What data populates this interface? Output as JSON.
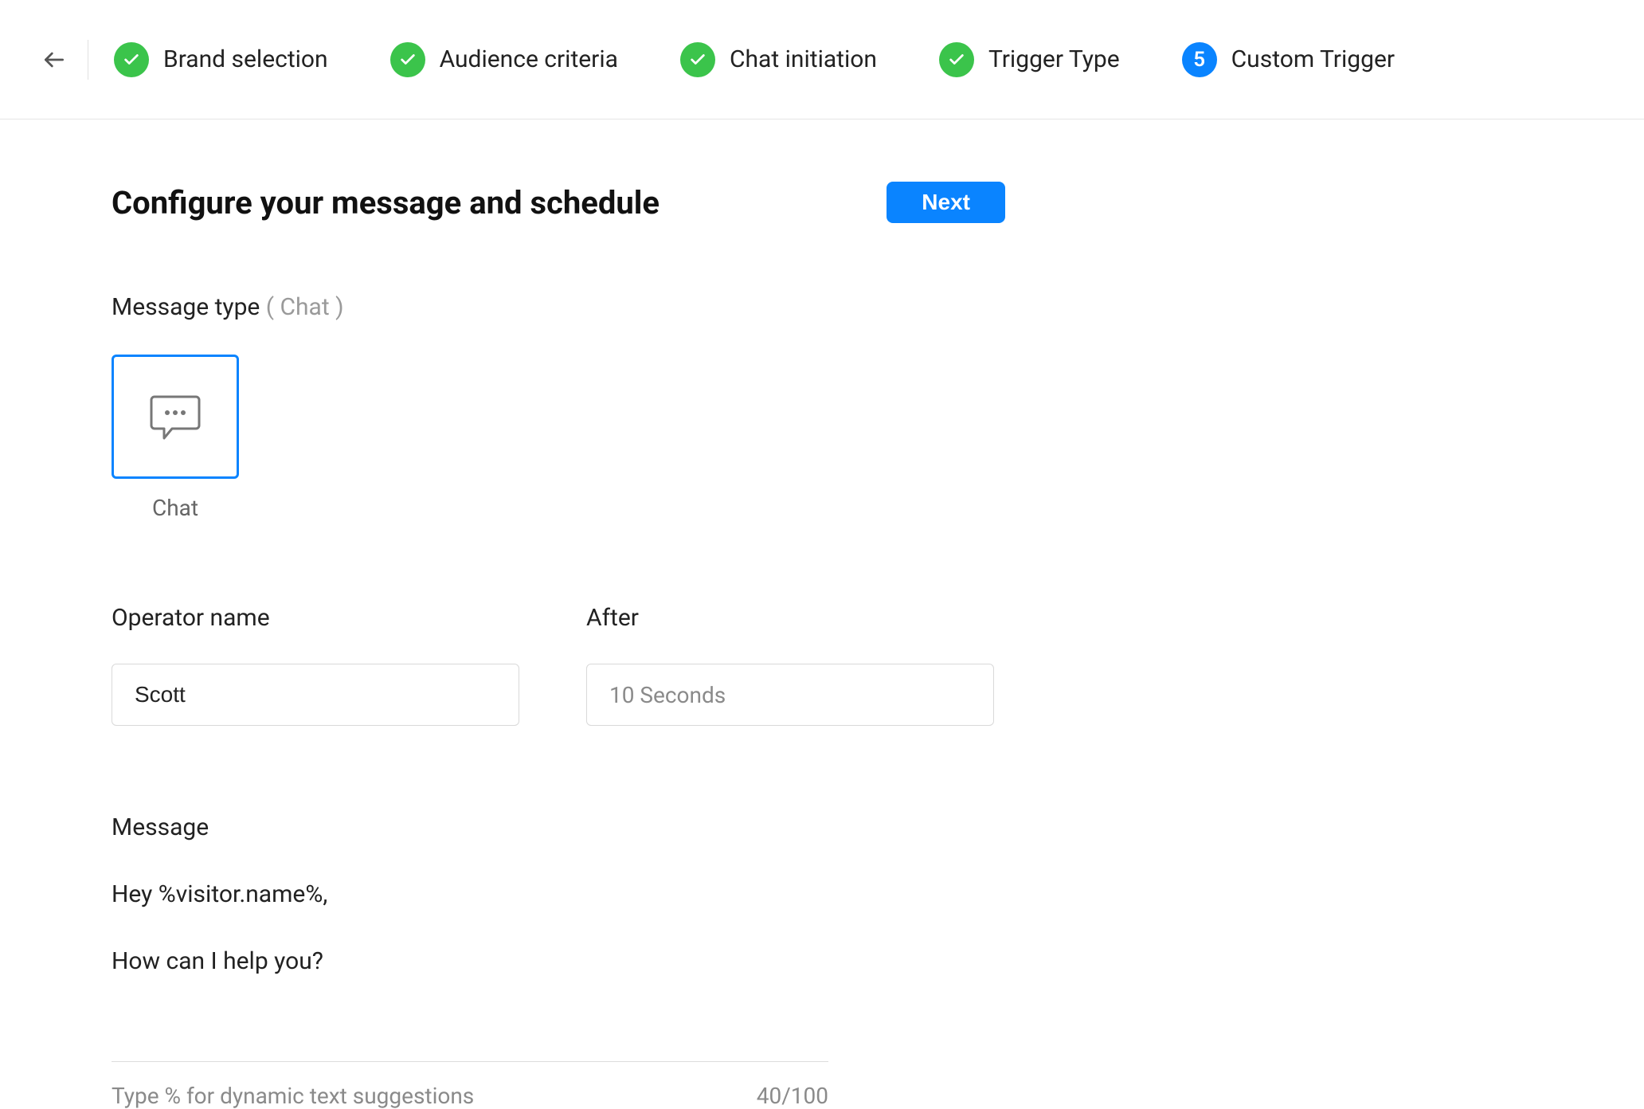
{
  "stepper": {
    "steps": [
      {
        "label": "Brand selection",
        "state": "done"
      },
      {
        "label": "Audience criteria",
        "state": "done"
      },
      {
        "label": "Chat initiation",
        "state": "done"
      },
      {
        "label": "Trigger Type",
        "state": "done"
      },
      {
        "label": "Custom Trigger",
        "state": "current",
        "number": "5"
      }
    ]
  },
  "page": {
    "title": "Configure your message and schedule",
    "next_label": "Next"
  },
  "message_type": {
    "label": "Message type",
    "selected_hint": "( Chat )",
    "options": [
      {
        "caption": "Chat"
      }
    ]
  },
  "operator": {
    "label": "Operator name",
    "value": "Scott"
  },
  "after": {
    "label": "After",
    "value": "10 Seconds"
  },
  "message": {
    "label": "Message",
    "body": "Hey %visitor.name%,\n\nHow can I help you?",
    "hint": "Type % for dynamic text suggestions",
    "counter": "40/100"
  }
}
